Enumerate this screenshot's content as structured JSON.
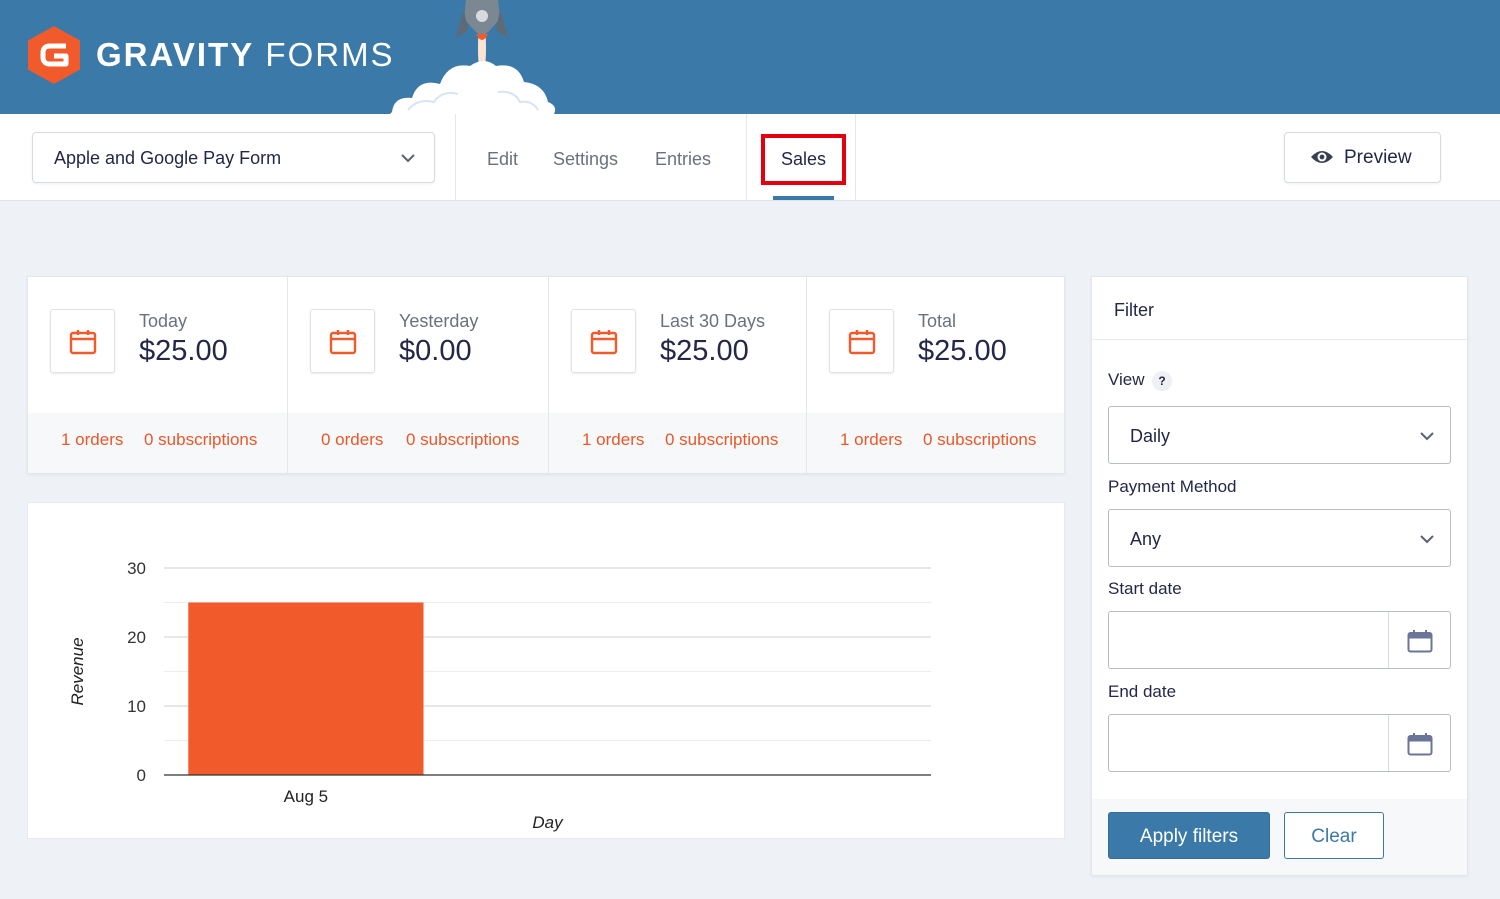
{
  "header": {
    "brand_bold": "GRAVITY",
    "brand_light": "FORMS"
  },
  "toolbar": {
    "form_select_value": "Apple and Google Pay Form",
    "nav": [
      "Edit",
      "Settings",
      "Entries",
      "Sales"
    ],
    "active_tab": "Sales",
    "preview_label": "Preview"
  },
  "stats": [
    {
      "label": "Today",
      "amount": "$25.00",
      "orders": "1 orders",
      "subscriptions": "0 subscriptions"
    },
    {
      "label": "Yesterday",
      "amount": "$0.00",
      "orders": "0 orders",
      "subscriptions": "0 subscriptions"
    },
    {
      "label": "Last 30 Days",
      "amount": "$25.00",
      "orders": "1 orders",
      "subscriptions": "0 subscriptions"
    },
    {
      "label": "Total",
      "amount": "$25.00",
      "orders": "1 orders",
      "subscriptions": "0 subscriptions"
    }
  ],
  "chart_data": {
    "type": "bar",
    "categories": [
      "Aug 5"
    ],
    "values": [
      25
    ],
    "xlabel": "Day",
    "ylabel": "Revenue",
    "ylim": [
      0,
      30
    ],
    "yticks": [
      0,
      10,
      20,
      30
    ],
    "color": "#f15a2b",
    "grid": true,
    "xlim_slots": 3
  },
  "filter": {
    "title": "Filter",
    "view_label": "View",
    "help_glyph": "?",
    "view_value": "Daily",
    "payment_label": "Payment Method",
    "payment_value": "Any",
    "start_label": "Start date",
    "start_value": "",
    "end_label": "End date",
    "end_value": "",
    "apply_label": "Apply filters",
    "clear_label": "Clear"
  },
  "colors": {
    "header_bg": "#3b79a8",
    "accent": "#e8582a",
    "highlight": "#e4000f"
  },
  "icons": {
    "logo": "gravity-forms-logo",
    "preview": "eye-icon",
    "stat": "calendar-icon",
    "dropdown": "chevron-down-icon"
  }
}
